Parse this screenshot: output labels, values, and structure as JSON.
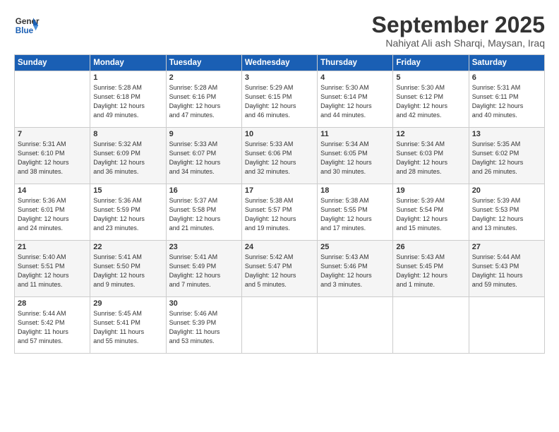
{
  "header": {
    "logo_line1": "General",
    "logo_line2": "Blue",
    "month_title": "September 2025",
    "subtitle": "Nahiyat Ali ash Sharqi, Maysan, Iraq"
  },
  "weekdays": [
    "Sunday",
    "Monday",
    "Tuesday",
    "Wednesday",
    "Thursday",
    "Friday",
    "Saturday"
  ],
  "weeks": [
    [
      {
        "day": "",
        "info": ""
      },
      {
        "day": "1",
        "info": "Sunrise: 5:28 AM\nSunset: 6:18 PM\nDaylight: 12 hours\nand 49 minutes."
      },
      {
        "day": "2",
        "info": "Sunrise: 5:28 AM\nSunset: 6:16 PM\nDaylight: 12 hours\nand 47 minutes."
      },
      {
        "day": "3",
        "info": "Sunrise: 5:29 AM\nSunset: 6:15 PM\nDaylight: 12 hours\nand 46 minutes."
      },
      {
        "day": "4",
        "info": "Sunrise: 5:30 AM\nSunset: 6:14 PM\nDaylight: 12 hours\nand 44 minutes."
      },
      {
        "day": "5",
        "info": "Sunrise: 5:30 AM\nSunset: 6:12 PM\nDaylight: 12 hours\nand 42 minutes."
      },
      {
        "day": "6",
        "info": "Sunrise: 5:31 AM\nSunset: 6:11 PM\nDaylight: 12 hours\nand 40 minutes."
      }
    ],
    [
      {
        "day": "7",
        "info": "Sunrise: 5:31 AM\nSunset: 6:10 PM\nDaylight: 12 hours\nand 38 minutes."
      },
      {
        "day": "8",
        "info": "Sunrise: 5:32 AM\nSunset: 6:09 PM\nDaylight: 12 hours\nand 36 minutes."
      },
      {
        "day": "9",
        "info": "Sunrise: 5:33 AM\nSunset: 6:07 PM\nDaylight: 12 hours\nand 34 minutes."
      },
      {
        "day": "10",
        "info": "Sunrise: 5:33 AM\nSunset: 6:06 PM\nDaylight: 12 hours\nand 32 minutes."
      },
      {
        "day": "11",
        "info": "Sunrise: 5:34 AM\nSunset: 6:05 PM\nDaylight: 12 hours\nand 30 minutes."
      },
      {
        "day": "12",
        "info": "Sunrise: 5:34 AM\nSunset: 6:03 PM\nDaylight: 12 hours\nand 28 minutes."
      },
      {
        "day": "13",
        "info": "Sunrise: 5:35 AM\nSunset: 6:02 PM\nDaylight: 12 hours\nand 26 minutes."
      }
    ],
    [
      {
        "day": "14",
        "info": "Sunrise: 5:36 AM\nSunset: 6:01 PM\nDaylight: 12 hours\nand 24 minutes."
      },
      {
        "day": "15",
        "info": "Sunrise: 5:36 AM\nSunset: 5:59 PM\nDaylight: 12 hours\nand 23 minutes."
      },
      {
        "day": "16",
        "info": "Sunrise: 5:37 AM\nSunset: 5:58 PM\nDaylight: 12 hours\nand 21 minutes."
      },
      {
        "day": "17",
        "info": "Sunrise: 5:38 AM\nSunset: 5:57 PM\nDaylight: 12 hours\nand 19 minutes."
      },
      {
        "day": "18",
        "info": "Sunrise: 5:38 AM\nSunset: 5:55 PM\nDaylight: 12 hours\nand 17 minutes."
      },
      {
        "day": "19",
        "info": "Sunrise: 5:39 AM\nSunset: 5:54 PM\nDaylight: 12 hours\nand 15 minutes."
      },
      {
        "day": "20",
        "info": "Sunrise: 5:39 AM\nSunset: 5:53 PM\nDaylight: 12 hours\nand 13 minutes."
      }
    ],
    [
      {
        "day": "21",
        "info": "Sunrise: 5:40 AM\nSunset: 5:51 PM\nDaylight: 12 hours\nand 11 minutes."
      },
      {
        "day": "22",
        "info": "Sunrise: 5:41 AM\nSunset: 5:50 PM\nDaylight: 12 hours\nand 9 minutes."
      },
      {
        "day": "23",
        "info": "Sunrise: 5:41 AM\nSunset: 5:49 PM\nDaylight: 12 hours\nand 7 minutes."
      },
      {
        "day": "24",
        "info": "Sunrise: 5:42 AM\nSunset: 5:47 PM\nDaylight: 12 hours\nand 5 minutes."
      },
      {
        "day": "25",
        "info": "Sunrise: 5:43 AM\nSunset: 5:46 PM\nDaylight: 12 hours\nand 3 minutes."
      },
      {
        "day": "26",
        "info": "Sunrise: 5:43 AM\nSunset: 5:45 PM\nDaylight: 12 hours\nand 1 minute."
      },
      {
        "day": "27",
        "info": "Sunrise: 5:44 AM\nSunset: 5:43 PM\nDaylight: 11 hours\nand 59 minutes."
      }
    ],
    [
      {
        "day": "28",
        "info": "Sunrise: 5:44 AM\nSunset: 5:42 PM\nDaylight: 11 hours\nand 57 minutes."
      },
      {
        "day": "29",
        "info": "Sunrise: 5:45 AM\nSunset: 5:41 PM\nDaylight: 11 hours\nand 55 minutes."
      },
      {
        "day": "30",
        "info": "Sunrise: 5:46 AM\nSunset: 5:39 PM\nDaylight: 11 hours\nand 53 minutes."
      },
      {
        "day": "",
        "info": ""
      },
      {
        "day": "",
        "info": ""
      },
      {
        "day": "",
        "info": ""
      },
      {
        "day": "",
        "info": ""
      }
    ]
  ]
}
